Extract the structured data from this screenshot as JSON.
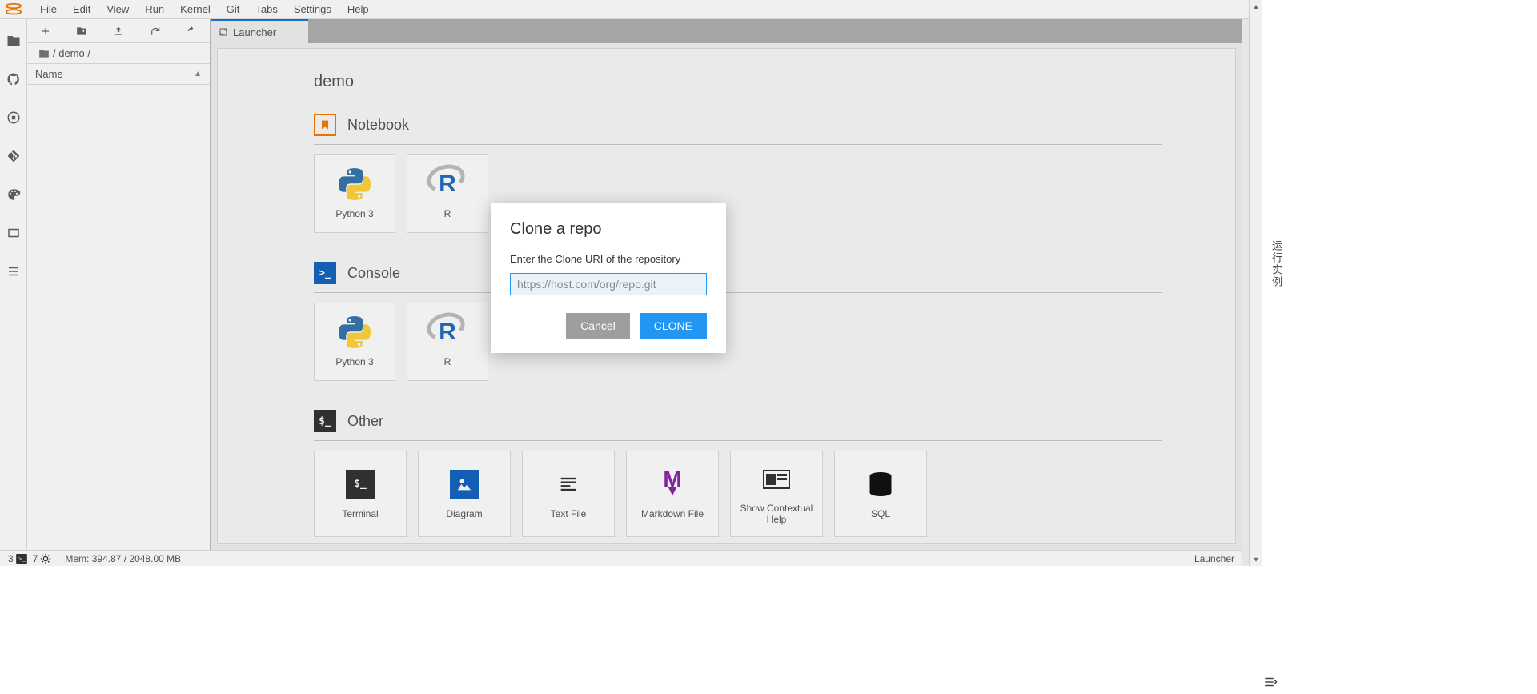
{
  "menu": {
    "items": [
      "File",
      "Edit",
      "View",
      "Run",
      "Kernel",
      "Git",
      "Tabs",
      "Settings",
      "Help"
    ]
  },
  "breadcrumb": {
    "path": "/ demo /"
  },
  "filebrowser": {
    "header": "Name"
  },
  "tab": {
    "label": "Launcher"
  },
  "launcher": {
    "title": "demo",
    "sections": {
      "notebook": {
        "label": "Notebook",
        "cards": [
          "Python 3",
          "R"
        ]
      },
      "console": {
        "label": "Console",
        "cards": [
          "Python 3",
          "R"
        ]
      },
      "other": {
        "label": "Other",
        "cards": [
          "Terminal",
          "Diagram",
          "Text File",
          "Markdown File",
          "Show Contextual Help",
          "SQL"
        ]
      }
    }
  },
  "dialog": {
    "title": "Clone a repo",
    "prompt": "Enter the Clone URI of the repository",
    "placeholder": "https://host.com/org/repo.git",
    "cancel": "Cancel",
    "clone": "CLONE"
  },
  "status": {
    "left_num1": "3",
    "left_num2": "7",
    "mem": "Mem: 394.87 / 2048.00 MB",
    "right": "Launcher"
  },
  "side_widget": "运行实例"
}
